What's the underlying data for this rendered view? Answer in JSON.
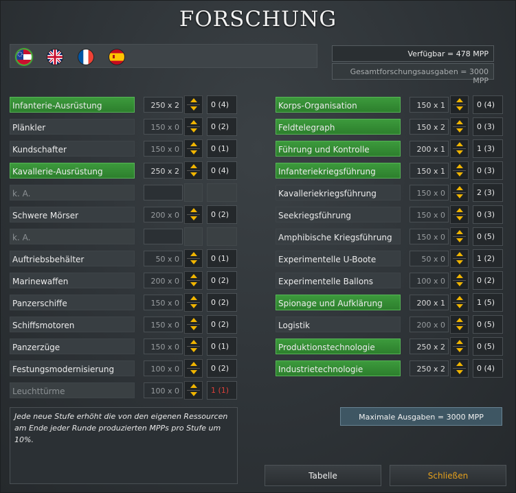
{
  "title": "FORSCHUNG",
  "flags": [
    {
      "icon": "csa-flag-icon",
      "active": true
    },
    {
      "icon": "uk-flag-icon",
      "active": false
    },
    {
      "icon": "france-flag-icon",
      "active": false
    },
    {
      "icon": "spain-flag-icon",
      "active": false
    }
  ],
  "available": "Verfügbar = 478 MPP",
  "total_spending": "Gesamtforschungsausgaben = 3000 MPP",
  "left_column": [
    {
      "name": "Infanterie-Ausrüstung",
      "cost": "250 x 2",
      "level": "0 (4)",
      "state": "green"
    },
    {
      "name": "Plänkler",
      "cost": "150 x 0",
      "level": "0 (2)",
      "state": "normal"
    },
    {
      "name": "Kundschafter",
      "cost": "150 x 0",
      "level": "0 (1)",
      "state": "normal"
    },
    {
      "name": "Kavallerie-Ausrüstung",
      "cost": "250 x 2",
      "level": "0 (4)",
      "state": "green"
    },
    {
      "name": "k. A.",
      "cost": "",
      "level": "",
      "state": "empty"
    },
    {
      "name": "Schwere Mörser",
      "cost": "200 x 0",
      "level": "0 (2)",
      "state": "normal"
    },
    {
      "name": "k. A.",
      "cost": "",
      "level": "",
      "state": "empty"
    },
    {
      "name": "Auftriebsbehälter",
      "cost": "50 x 0",
      "level": "0 (1)",
      "state": "normal"
    },
    {
      "name": "Marinewaffen",
      "cost": "200 x 0",
      "level": "0 (2)",
      "state": "normal"
    },
    {
      "name": "Panzerschiffe",
      "cost": "150 x 0",
      "level": "0 (2)",
      "state": "normal"
    },
    {
      "name": "Schiffsmotoren",
      "cost": "150 x 0",
      "level": "0 (2)",
      "state": "normal"
    },
    {
      "name": "Panzerzüge",
      "cost": "150 x 0",
      "level": "0 (1)",
      "state": "normal"
    },
    {
      "name": "Festungsmodernisierung",
      "cost": "100 x 0",
      "level": "0 (2)",
      "state": "normal"
    },
    {
      "name": "Leuchttürme",
      "cost": "100 x 0",
      "level": "1 (1)",
      "state": "maxed"
    }
  ],
  "right_column": [
    {
      "name": "Korps-Organisation",
      "cost": "150 x 1",
      "level": "0 (4)",
      "state": "green"
    },
    {
      "name": "Feldtelegraph",
      "cost": "150 x 2",
      "level": "0 (3)",
      "state": "green"
    },
    {
      "name": "Führung und Kontrolle",
      "cost": "200 x 1",
      "level": "1 (3)",
      "state": "green"
    },
    {
      "name": "Infanteriekriegsführung",
      "cost": "150 x 1",
      "level": "0 (3)",
      "state": "green"
    },
    {
      "name": "Kavalleriekriegsführung",
      "cost": "150 x 0",
      "level": "2 (3)",
      "state": "normal"
    },
    {
      "name": "Seekriegsführung",
      "cost": "150 x 0",
      "level": "0 (3)",
      "state": "normal"
    },
    {
      "name": "Amphibische Kriegsführung",
      "cost": "150 x 0",
      "level": "0 (5)",
      "state": "normal"
    },
    {
      "name": "Experimentelle U-Boote",
      "cost": "50 x 0",
      "level": "1 (2)",
      "state": "normal"
    },
    {
      "name": "Experimentelle Ballons",
      "cost": "100 x 0",
      "level": "0 (2)",
      "state": "normal"
    },
    {
      "name": "Spionage und Aufklärung",
      "cost": "200 x 1",
      "level": "1 (5)",
      "state": "green"
    },
    {
      "name": "Logistik",
      "cost": "200 x 0",
      "level": "0 (5)",
      "state": "normal"
    },
    {
      "name": "Produktionstechnologie",
      "cost": "250 x 2",
      "level": "0 (5)",
      "state": "green"
    },
    {
      "name": "Industrietechnologie",
      "cost": "250 x 2",
      "level": "0 (4)",
      "state": "green"
    }
  ],
  "description": "Jede neue Stufe erhöht die von den eigenen Ressourcen am Ende jeder Runde produzierten MPPs pro Stufe um 10%.",
  "max_spending": "Maximale Ausgaben =    3000 MPP",
  "buttons": {
    "table": "Tabelle",
    "close": "Schließen"
  },
  "colors": {
    "green": "#3c9a3c",
    "accent": "#f0b400",
    "red": "#e0413a",
    "close_text": "#e6a11c"
  }
}
